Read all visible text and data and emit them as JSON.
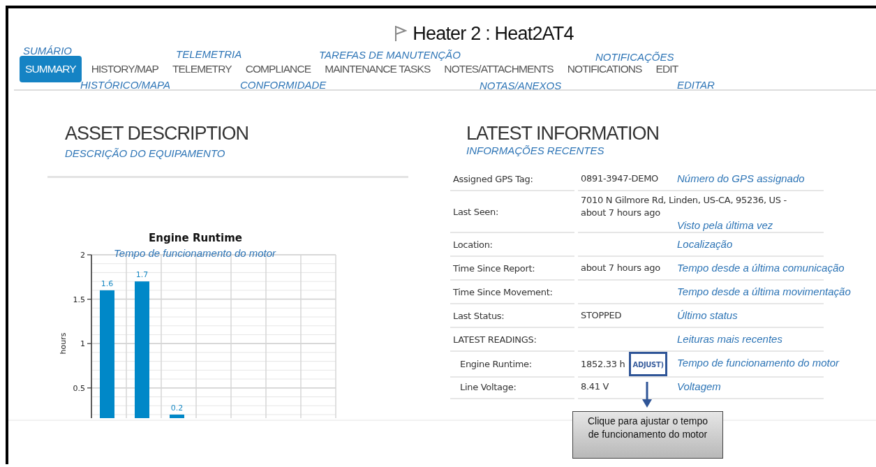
{
  "title": "Heater 2 : Heat2AT4",
  "tabs": [
    {
      "label": "SUMMARY",
      "selected": true,
      "translation": "SUMÁRIO"
    },
    {
      "label": "HISTORY/MAP",
      "selected": false,
      "translation": "HISTÓRICO/MAPA"
    },
    {
      "label": "TELEMETRY",
      "selected": false,
      "translation": "TELEMETRIA"
    },
    {
      "label": "COMPLIANCE",
      "selected": false,
      "translation": "CONFORMIDADE"
    },
    {
      "label": "MAINTENANCE TASKS",
      "selected": false,
      "translation": "TAREFAS DE MANUTENÇÃO"
    },
    {
      "label": "NOTES/ATTACHMENTS",
      "selected": false,
      "translation": "NOTAS/ANEXOS"
    },
    {
      "label": "NOTIFICATIONS",
      "selected": false,
      "translation": "NOTIFICAÇÕES"
    },
    {
      "label": "EDIT",
      "selected": false,
      "translation": "EDITAR"
    }
  ],
  "asset_description": {
    "heading": "ASSET DESCRIPTION",
    "translation": "DESCRIÇÃO DO EQUIPAMENTO",
    "chart_translation": "Tempo de funcionamento do motor",
    "chart_data": {
      "type": "bar",
      "title": "Engine Runtime",
      "ylabel": "hours",
      "values": [
        1.6,
        1.7,
        0.2,
        null,
        null,
        null,
        null
      ],
      "ylim": [
        0.16,
        2
      ],
      "yticks": [
        0.5,
        1,
        1.5,
        2
      ],
      "grid": true,
      "data_labels": true
    }
  },
  "latest_information": {
    "heading": "LATEST INFORMATION",
    "translation": "INFORMAÇÕES RECENTES",
    "rows": [
      {
        "kind": "field",
        "label": "Assigned GPS Tag:",
        "value": "0891-3947-DEMO",
        "translation": "Número do GPS assignado"
      },
      {
        "kind": "field",
        "label": "Last Seen:",
        "value": "7010 N Gilmore Rd, Linden, US-CA, 95236, US - about 7 hours ago",
        "translation": "Visto pela última vez"
      },
      {
        "kind": "field",
        "label": "Location:",
        "translation": "Localização"
      },
      {
        "kind": "field",
        "label": "Time Since Report:",
        "value": "about 7 hours ago",
        "translation": "Tempo desde a última comunicação"
      },
      {
        "kind": "field",
        "label": "Time Since Movement:",
        "translation": "Tempo desde a última movimentação"
      },
      {
        "kind": "field",
        "label": "Last Status:",
        "value": "STOPPED",
        "translation": "Último status"
      },
      {
        "kind": "heading",
        "label": "LATEST READINGS:",
        "translation": "Leituras mais recentes"
      },
      {
        "kind": "reading",
        "label": "Engine Runtime:",
        "value": "1852.33 h",
        "action": "ADJUST)",
        "translation": "Tempo de funcionamento do motor"
      },
      {
        "kind": "reading",
        "label": "Line Voltage:",
        "value": "8.41 V",
        "translation": "Voltagem"
      }
    ]
  },
  "callout": "Clique para ajustar o tempo de funcionamento do motor"
}
